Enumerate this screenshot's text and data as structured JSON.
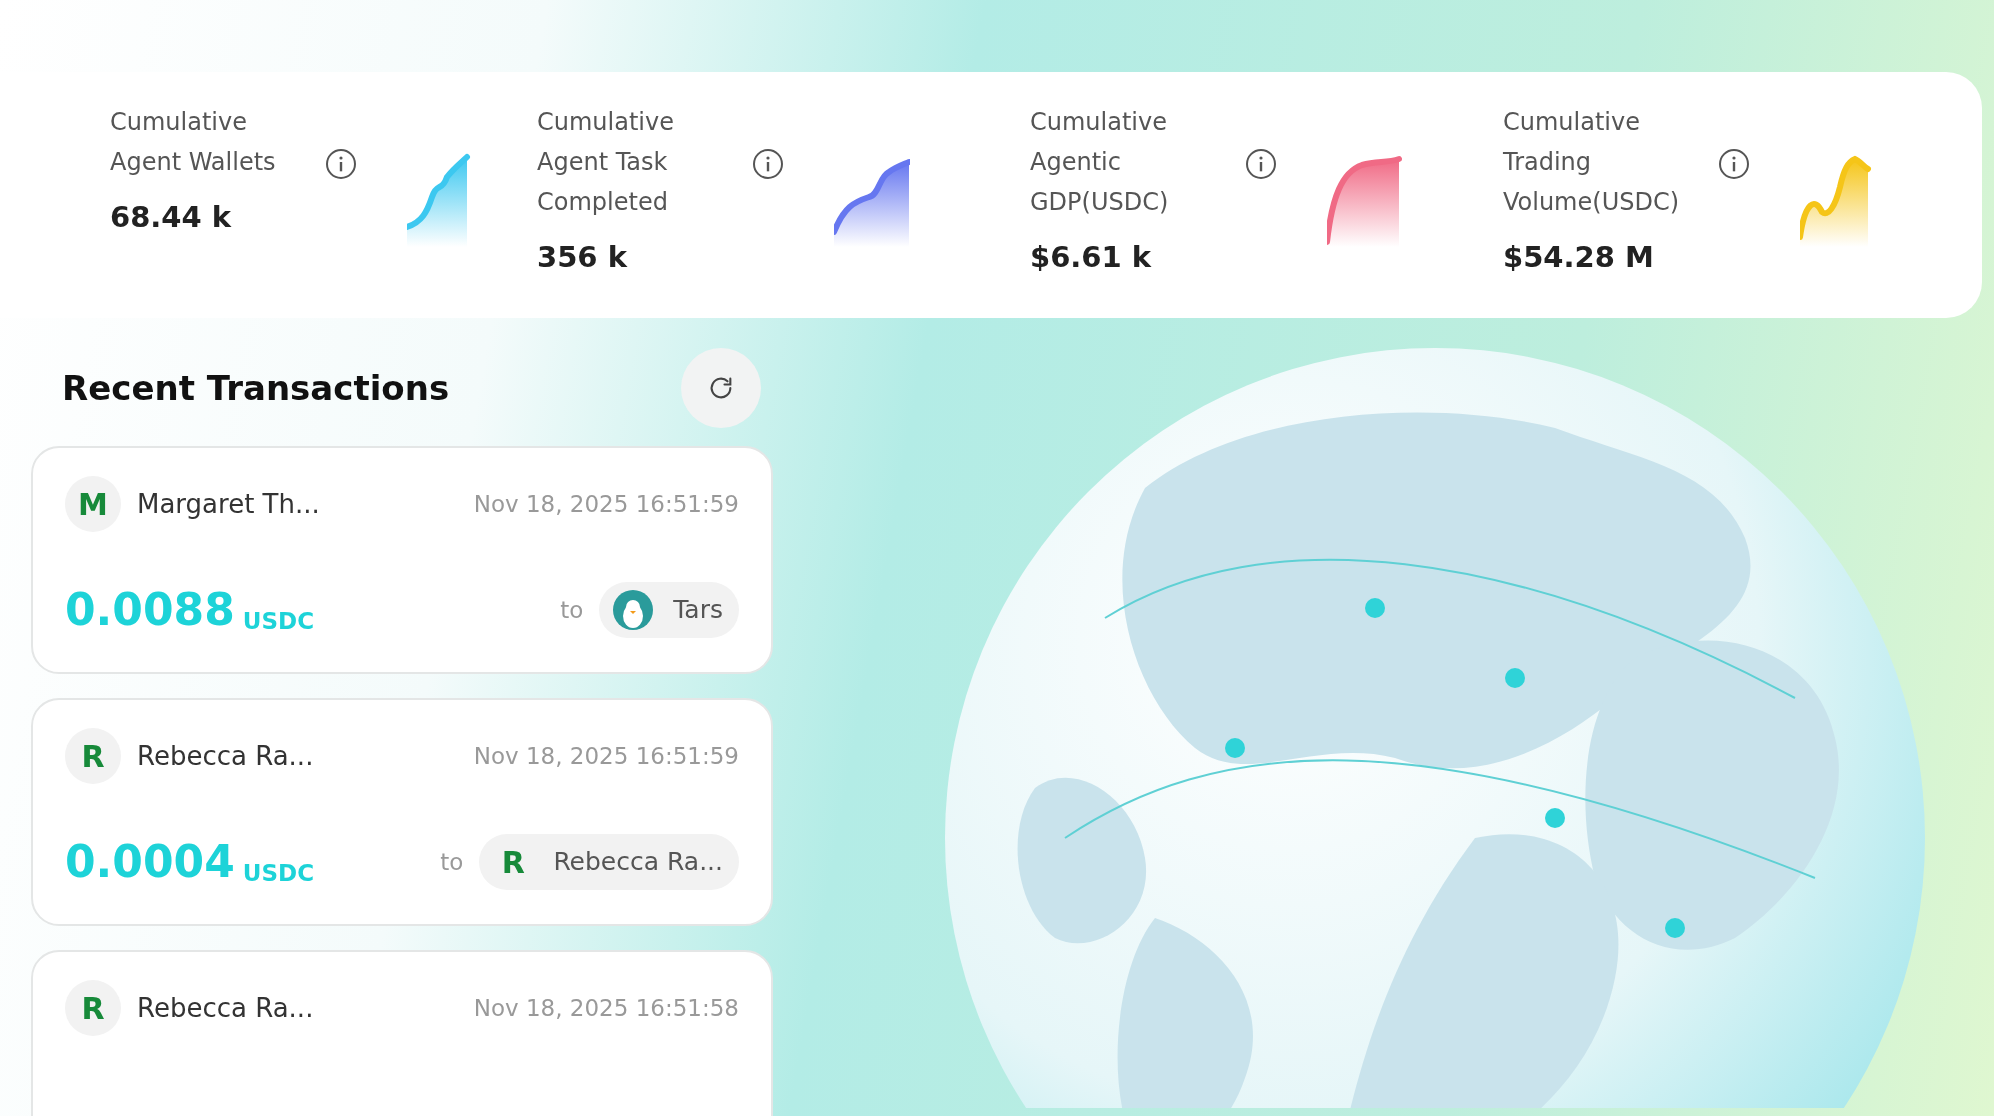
{
  "stats": [
    {
      "label": "Cumulative Agent Wallets",
      "value": "68.44 k",
      "color": "#3cc8f0"
    },
    {
      "label": "Cumulative Agent Task Completed",
      "value": "356 k",
      "color": "#6677f0"
    },
    {
      "label": "Cumulative Agentic GDP(USDC)",
      "value": "$6.61 k",
      "color": "#f06a85"
    },
    {
      "label": "Cumulative Trading Volume(USDC)",
      "value": "$54.28 M",
      "color": "#f5c518"
    }
  ],
  "transactions_title": "Recent Transactions",
  "transactions": [
    {
      "sender": {
        "letter": "M",
        "name": "Margaret Th..."
      },
      "time": "Nov 18, 2025 16:51:59",
      "amount": "0.0088",
      "unit": "USDC",
      "to": "to",
      "recipient": {
        "name": "Tars"
      }
    },
    {
      "sender": {
        "letter": "R",
        "name": "Rebecca Ra..."
      },
      "time": "Nov 18, 2025 16:51:59",
      "amount": "0.0004",
      "unit": "USDC",
      "to": "to",
      "recipient": {
        "kind": "letter",
        "letter": "R",
        "name": "Rebecca Ra..."
      }
    },
    {
      "sender": {
        "letter": "R",
        "name": "Rebecca Ra..."
      },
      "time": "Nov 18, 2025 16:51:58"
    }
  ]
}
